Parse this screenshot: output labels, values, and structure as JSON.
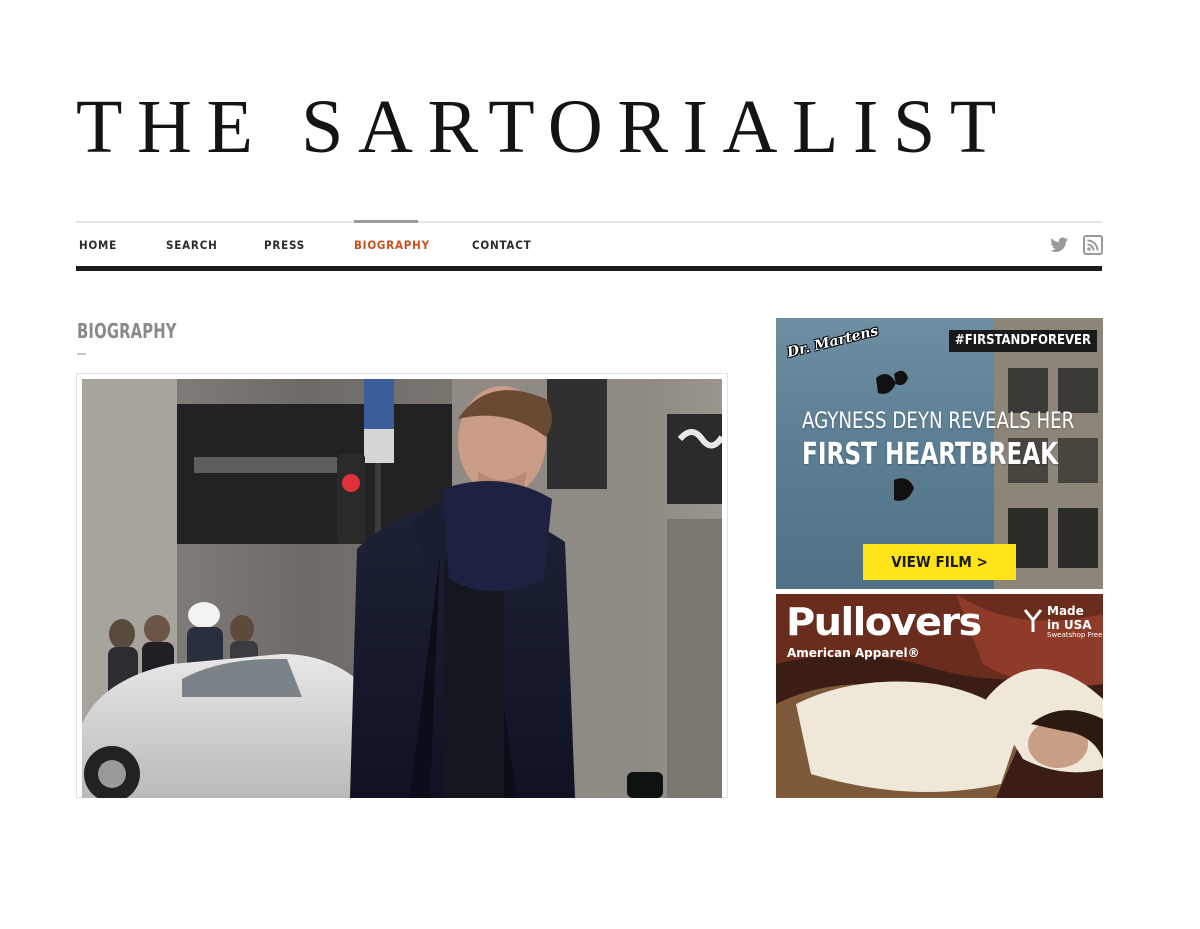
{
  "site": {
    "title": "THE SARTORIALIST"
  },
  "nav": {
    "items": [
      {
        "label": "HOME",
        "active": false
      },
      {
        "label": "SEARCH",
        "active": false
      },
      {
        "label": "PRESS",
        "active": false
      },
      {
        "label": "BIOGRAPHY",
        "active": true
      },
      {
        "label": "CONTACT",
        "active": false
      }
    ],
    "social_icons": [
      "twitter-icon",
      "rss-icon"
    ]
  },
  "page": {
    "section_title": "BIOGRAPHY"
  },
  "ads": {
    "drmartens": {
      "logo_text": "Dr. Martens",
      "hashtag": "#FIRSTANDFOREVER",
      "headline_line1": "AGYNESS DEYN REVEALS HER",
      "headline_line2": "FIRST HEARTBREAK",
      "cta": "VIEW FILM >"
    },
    "american_apparel": {
      "title": "Pullovers",
      "brand": "American Apparel®",
      "badge_line1": "Made",
      "badge_line2": "in USA",
      "badge_sub": "Sweatshop Free"
    }
  },
  "colors": {
    "accent": "#c8501c",
    "nav_text": "#2b2b2b",
    "heading_gray": "#8a8a8a",
    "cta_yellow": "#ffe319"
  }
}
